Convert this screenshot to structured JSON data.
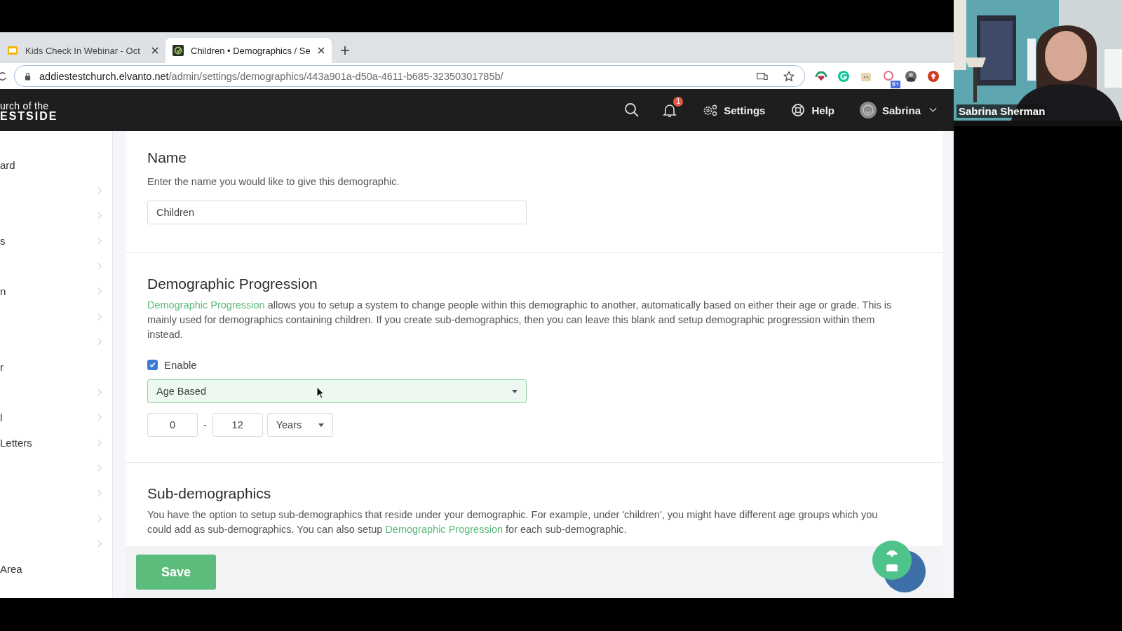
{
  "browser": {
    "tabs": [
      {
        "title": "Kids Check In Webinar - Oct",
        "selected": false
      },
      {
        "title": "Children • Demographics / Se",
        "selected": true
      }
    ],
    "url_host": "addiestestchurch.elvanto.net",
    "url_path": "/admin/settings/demographics/443a901a-d50a-4611-b685-32350301785b/",
    "extension_badge": "9+"
  },
  "app_header": {
    "logo_line_1": "urch of the",
    "logo_line_2": "ESTSIDE",
    "notification_count": "1",
    "settings": "Settings",
    "help": "Help",
    "user": "Sabrina"
  },
  "sidebar": {
    "items": [
      {
        "label": "ard",
        "has_submenu": false
      },
      {
        "has_submenu": true
      },
      {
        "has_submenu": true
      },
      {
        "label": "s",
        "has_submenu": true
      },
      {
        "has_submenu": true
      },
      {
        "label": "n",
        "has_submenu": true
      },
      {
        "has_submenu": true
      },
      {
        "has_submenu": true
      },
      {
        "label": "r",
        "has_submenu": false
      },
      {
        "has_submenu": true
      },
      {
        "label": "l",
        "has_submenu": true
      },
      {
        "label": "Letters",
        "has_submenu": true
      },
      {
        "has_submenu": true
      },
      {
        "has_submenu": true
      },
      {
        "has_submenu": true
      },
      {
        "has_submenu": true
      },
      {
        "label": "Area",
        "has_submenu": false
      }
    ]
  },
  "name_section": {
    "heading": "Name",
    "description": "Enter the name you would like to give this demographic.",
    "value": "Children"
  },
  "progression_section": {
    "heading": "Demographic Progression",
    "link": "Demographic Progression",
    "text": " allows you to setup a system to change people within this demographic to another, automatically based on either their age or grade. This is mainly used for demographics containing children. If you create sub-demographics, then you can leave this blank and setup demographic progression within them instead.",
    "enable_label": "Enable",
    "enabled": true,
    "mode": "Age Based",
    "from": "0",
    "separator": "-",
    "to": "12",
    "unit": "Years"
  },
  "sub_section": {
    "heading": "Sub-demographics",
    "text_before": "You have the option to setup sub-demographics that reside under your demographic. For example, under 'children', you might have different age groups which you could add as sub-demographics. You can also setup ",
    "link": "Demographic Progression",
    "text_after": " for each sub-demographic."
  },
  "save_button": "Save",
  "video": {
    "participant": "Sabrina Sherman"
  }
}
